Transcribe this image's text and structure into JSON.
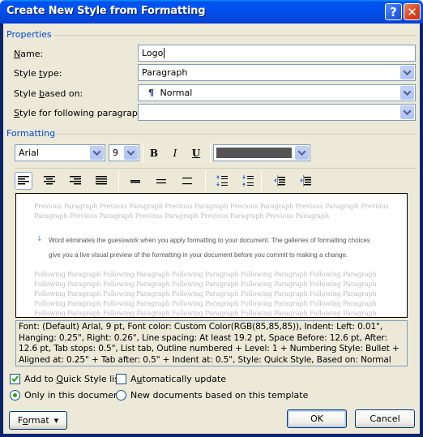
{
  "window": {
    "title": "Create New Style from Formatting",
    "help_icon": "help-icon",
    "close_icon": "close-icon"
  },
  "properties": {
    "group_label": "Properties",
    "name_label": "Name:",
    "name_value": "Logo",
    "style_type_label": "Style type:",
    "style_type_value": "Paragraph",
    "based_on_label": "Style based on:",
    "based_on_value": "Normal",
    "based_on_icon": "pilcrow-icon",
    "following_label": "Style for following paragraph:",
    "following_value": ""
  },
  "formatting": {
    "group_label": "Formatting",
    "font": "Arial",
    "size": "9",
    "bold_label": "B",
    "italic_label": "I",
    "underline_label": "U",
    "font_color": "#555555",
    "toolbar_icons": [
      "align-left-icon",
      "align-center-icon",
      "align-right-icon",
      "justify-icon",
      "single-spacing-icon",
      "one-half-spacing-icon",
      "double-spacing-icon",
      "increase-paragraph-spacing-icon",
      "decrease-paragraph-spacing-icon",
      "decrease-indent-icon",
      "increase-indent-icon"
    ],
    "active_alignment": "align-left"
  },
  "preview": {
    "previous_line1": "Previous Paragraph Previous Paragraph Previous Paragraph Previous Paragraph Previous Paragraph Previous",
    "previous_line2": "Paragraph Previous Paragraph Previous Paragraph Previous Paragraph Previous Paragraph",
    "current_line1": "Word eliminates the guesswork when you apply formatting to your document. The galleries of formatting choices",
    "current_line2": "give you a live visual preview of the formatting in your document before you commit to making a change.",
    "following_line": "Following Paragraph Following Paragraph Following Paragraph Following Paragraph Following Paragraph"
  },
  "description": "Font: (Default) Arial, 9 pt, Font color: Custom Color(RGB(85,85,85)), Indent: Left:  0.01\", Hanging:  0.25\", Right:  0.26\", Line spacing:  At least 19.2 pt, Space Before:  12.6 pt, After:  12.6 pt, Tab stops:  0.5\", List tab, Outline numbered + Level: 1 + Numbering Style: Bullet + Aligned at:  0.25\" + Tab after:  0.5\" + Indent at:  0.5\", Style: Quick Style, Based on: Normal",
  "options": {
    "add_quick_style": {
      "label": "Add to Quick Style list",
      "checked": true
    },
    "auto_update": {
      "label": "Automatically update",
      "checked": false
    },
    "only_this_doc": {
      "label": "Only in this document",
      "selected": true
    },
    "new_docs": {
      "label": "New documents based on this template",
      "selected": false
    }
  },
  "buttons": {
    "format": "Format",
    "ok": "OK",
    "cancel": "Cancel"
  }
}
